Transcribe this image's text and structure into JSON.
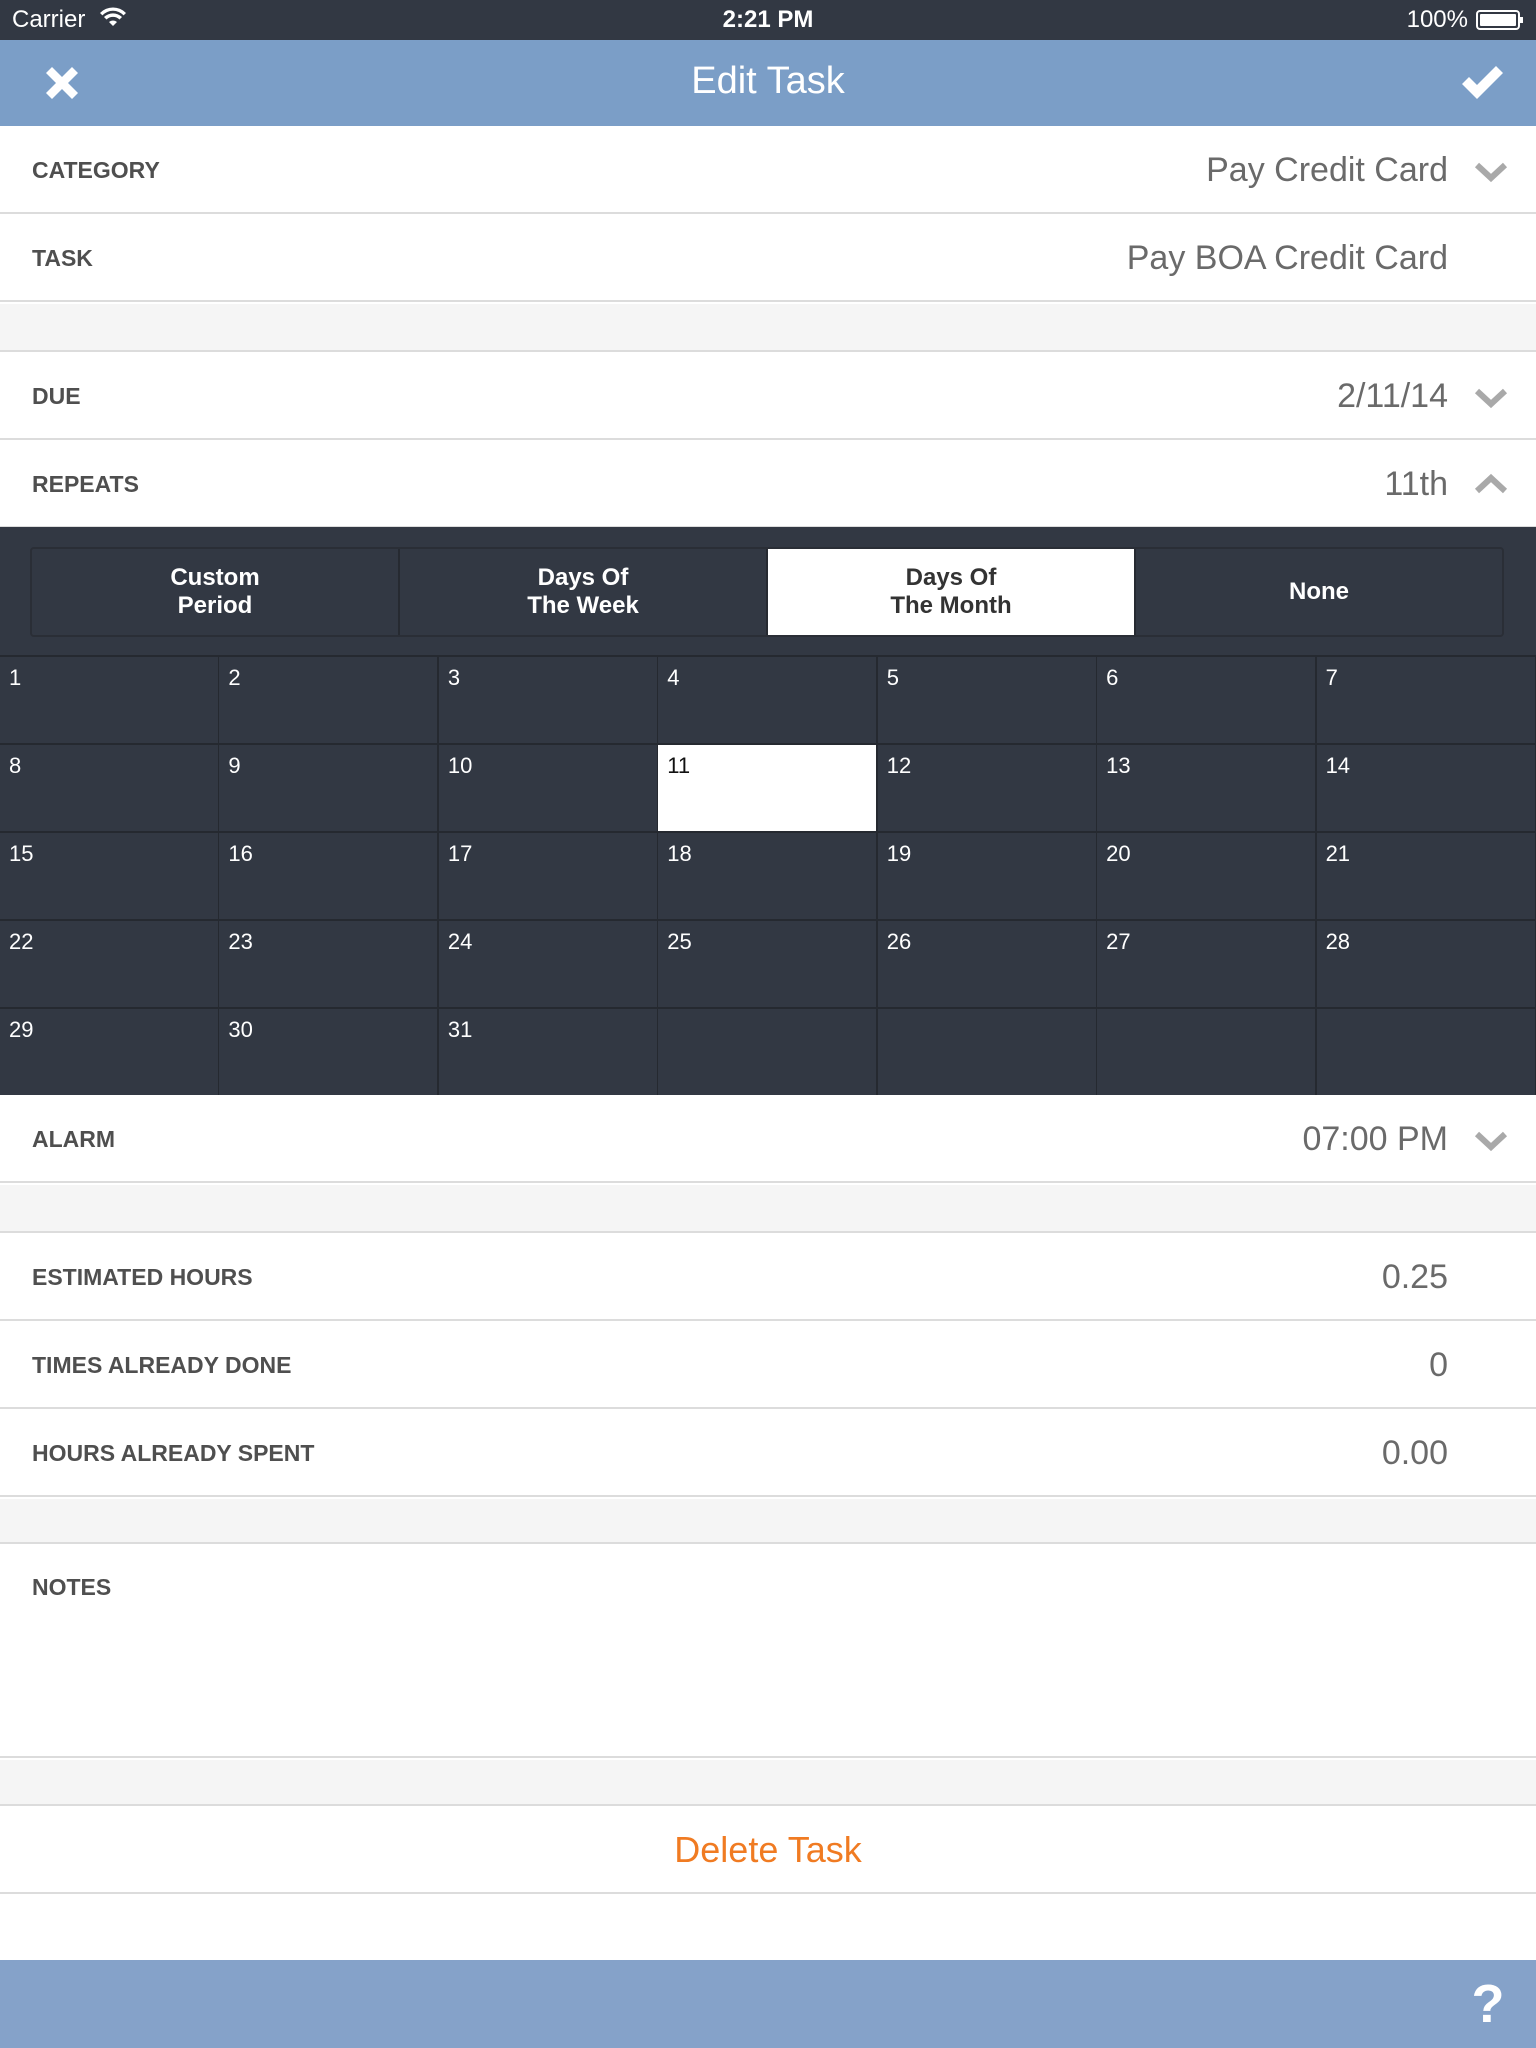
{
  "status_bar": {
    "carrier": "Carrier",
    "time": "2:21 PM",
    "battery": "100%"
  },
  "nav": {
    "title": "Edit Task",
    "close_icon": "close-icon",
    "confirm_icon": "checkmark-icon"
  },
  "fields": {
    "category": {
      "label": "CATEGORY",
      "value": "Pay Credit Card"
    },
    "task": {
      "label": "TASK",
      "value": "Pay BOA Credit Card"
    },
    "due": {
      "label": "DUE",
      "value": "2/11/14"
    },
    "repeats": {
      "label": "REPEATS",
      "value": "11th"
    },
    "alarm": {
      "label": "ALARM",
      "value": "07:00 PM"
    },
    "estimated_hours": {
      "label": "ESTIMATED HOURS",
      "value": "0.25"
    },
    "times_done": {
      "label": "TIMES ALREADY DONE",
      "value": "0"
    },
    "hours_spent": {
      "label": "HOURS ALREADY SPENT",
      "value": "0.00"
    },
    "notes": {
      "label": "NOTES",
      "value": ""
    }
  },
  "repeat_modes": [
    {
      "label": "Custom\nPeriod",
      "active": false
    },
    {
      "label": "Days Of\nThe Week",
      "active": false
    },
    {
      "label": "Days Of\nThe Month",
      "active": true
    },
    {
      "label": "None",
      "active": false
    }
  ],
  "month_days": [
    "1",
    "2",
    "3",
    "4",
    "5",
    "6",
    "7",
    "8",
    "9",
    "10",
    "11",
    "12",
    "13",
    "14",
    "15",
    "16",
    "17",
    "18",
    "19",
    "20",
    "21",
    "22",
    "23",
    "24",
    "25",
    "26",
    "27",
    "28",
    "29",
    "30",
    "31",
    "",
    "",
    "",
    ""
  ],
  "selected_day": "11",
  "actions": {
    "delete": "Delete Task",
    "help": "?"
  },
  "colors": {
    "nav": "#7b9ec7",
    "toolbar": "#85a2c9",
    "panel": "#323843",
    "delete": "#f07b22"
  }
}
